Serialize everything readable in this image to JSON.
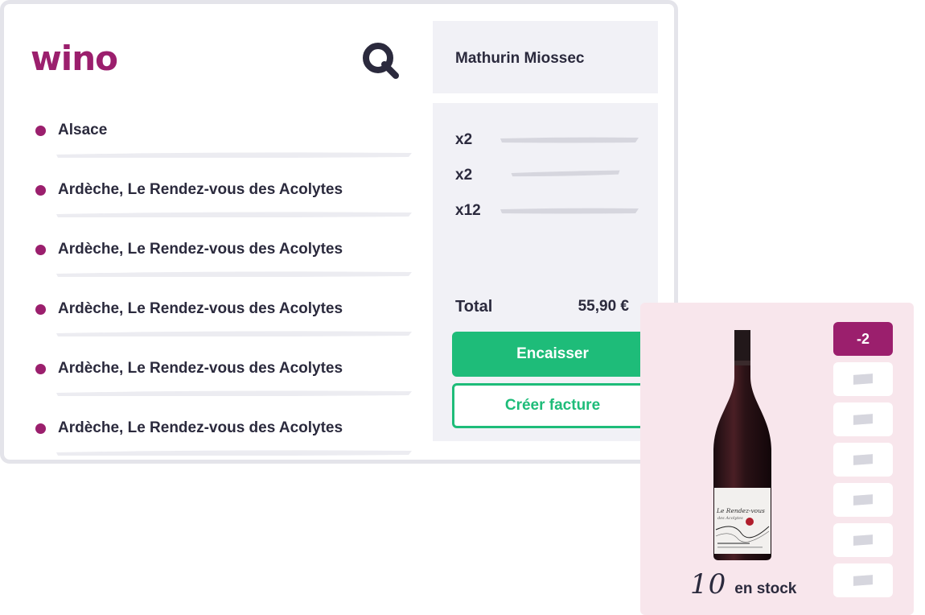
{
  "app": {
    "logo": "wino"
  },
  "regions": [
    {
      "name": "Alsace"
    },
    {
      "name": "Ardèche, Le Rendez-vous des Acolytes"
    },
    {
      "name": "Ardèche, Le Rendez-vous des Acolytes"
    },
    {
      "name": "Ardèche, Le Rendez-vous des Acolytes"
    },
    {
      "name": "Ardèche, Le Rendez-vous des Acolytes"
    },
    {
      "name": "Ardèche, Le Rendez-vous des Acolytes"
    }
  ],
  "client": {
    "name": "Mathurin Miossec"
  },
  "cart": {
    "lines": [
      {
        "qty": "x2"
      },
      {
        "qty": "x2"
      },
      {
        "qty": "x12"
      }
    ],
    "total_label": "Total",
    "total_value": "55,90 €"
  },
  "actions": {
    "checkout_label": "Encaisser",
    "invoice_label": "Créer facture"
  },
  "product": {
    "stock_count": "10",
    "stock_label": "en stock",
    "bottle_label_title": "Le Rendez-vous",
    "bottle_label_sub": "des Acolytes",
    "quick_qty": [
      "-2",
      "",
      "",
      "",
      "",
      "",
      ""
    ]
  },
  "colors": {
    "brand": "#9b1f6d",
    "accent_green": "#1ebc79",
    "panel_bg": "#f1f1f6",
    "card_bg": "#f8e6ec"
  }
}
